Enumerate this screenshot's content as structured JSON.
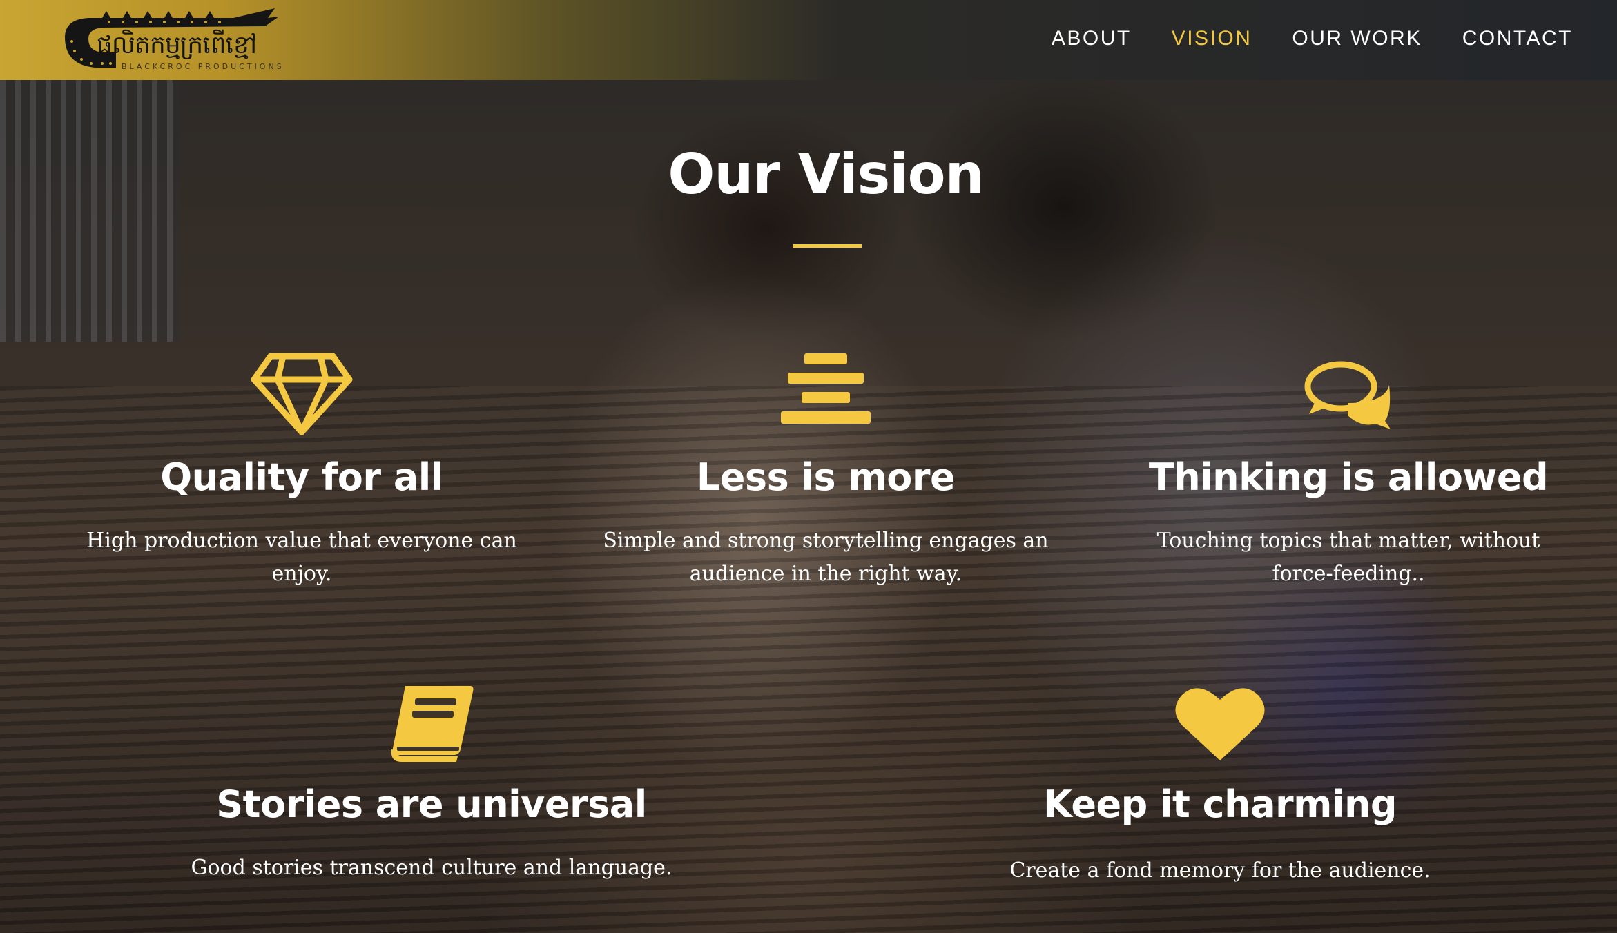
{
  "brand": {
    "logo_text": "ផលិតកម្មក្រពើខ្មៅ",
    "logo_subtext": "BLACKCROC PRODUCTIONS"
  },
  "nav": {
    "items": [
      {
        "label": "ABOUT",
        "active": false
      },
      {
        "label": "VISION",
        "active": true
      },
      {
        "label": "OUR WORK",
        "active": false
      },
      {
        "label": "CONTACT",
        "active": false
      }
    ]
  },
  "section": {
    "title": "Our Vision"
  },
  "features": [
    {
      "icon": "diamond-icon",
      "title": "Quality for all",
      "text": "High production value that everyone can enjoy."
    },
    {
      "icon": "align-center-icon",
      "title": "Less is more",
      "text": "Simple and strong storytelling engages an audience in the right way."
    },
    {
      "icon": "comments-icon",
      "title": "Thinking is allowed",
      "text": "Touching topics that matter, without force-feeding.."
    },
    {
      "icon": "book-icon",
      "title": "Stories are universal",
      "text": "Good stories transcend culture and language."
    },
    {
      "icon": "heart-icon",
      "title": "Keep it charming",
      "text": "Create a fond memory for the audience."
    }
  ],
  "colors": {
    "accent": "#f5c842",
    "header_gold": "#c9a533",
    "header_dark": "#23262a",
    "text": "#ffffff"
  }
}
